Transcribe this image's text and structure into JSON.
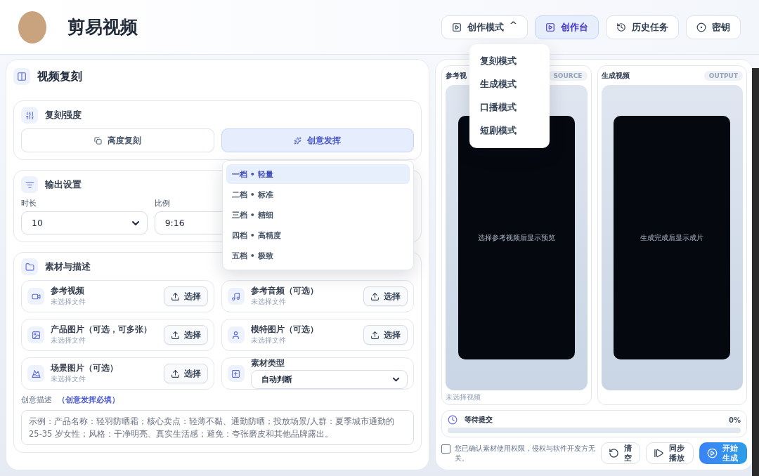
{
  "header": {
    "app_title": "剪易视频",
    "nav": [
      {
        "label": "创作模式",
        "caret": "^",
        "selected": false,
        "expanded": true
      },
      {
        "label": "创作台",
        "selected": true
      },
      {
        "label": "历史任务",
        "selected": false
      },
      {
        "label": "密钥",
        "selected": false
      }
    ]
  },
  "mode_menu": [
    "复刻模式",
    "生成模式",
    "口播模式",
    "短剧模式"
  ],
  "left_panel": {
    "title": "视频复刻",
    "strength": {
      "title": "复刻强度",
      "options": [
        {
          "label": "高度复刻",
          "selected": false
        },
        {
          "label": "创意发挥",
          "selected": true
        }
      ],
      "level_menu": [
        {
          "label": "一档 • 轻量",
          "selected": true
        },
        {
          "label": "二档 • 标准",
          "selected": false
        },
        {
          "label": "三档 • 精细",
          "selected": false
        },
        {
          "label": "四档 • 高精度",
          "selected": false
        },
        {
          "label": "五档 • 极致",
          "selected": false
        }
      ]
    },
    "output": {
      "title": "输出设置",
      "fields": [
        {
          "label": "时长",
          "value": "10"
        },
        {
          "label": "比例",
          "value": "9:16"
        }
      ]
    },
    "materials": {
      "title": "素材与描述",
      "uploads": [
        {
          "label": "参考视频",
          "status": "未选择文件",
          "button": "选择"
        },
        {
          "label": "参考音频（可选）",
          "status": "未选择文件",
          "button": "选择"
        },
        {
          "label": "产品图片（可选，可多张）",
          "status": "未选择文件",
          "button": "选择"
        },
        {
          "label": "模特图片（可选）",
          "status": "未选择文件",
          "button": "选择"
        },
        {
          "label": "场景图片（可选）",
          "status": "未选择文件",
          "button": "选择"
        }
      ],
      "type_field": {
        "label": "素材类型",
        "value": "自动判断"
      },
      "description": {
        "label": "创意描述",
        "hint": "（创意发挥必填）",
        "placeholder": "示例：产品名称：轻羽防晒霜；核心卖点：轻薄不黏、通勤防晒；投放场景/人群：夏季城市通勤的 25-35 岁女性；风格：干净明亮、真实生活感；避免：夸张磨皮和其他品牌露出。"
      }
    }
  },
  "right_panel": {
    "previews": [
      {
        "title": "参考视",
        "badge": "SOURCE",
        "message": "选择参考视频后显示预览",
        "caption": "未选择视频"
      },
      {
        "title": "生成视频",
        "badge": "OUTPUT",
        "message": "生成完成后显示成片"
      }
    ],
    "progress": {
      "status": "等待提交",
      "percent": "0%",
      "level": 0
    },
    "consent": {
      "text": "您已确认素材使用权限，侵权与软件开发方无关。",
      "checked": false
    },
    "buttons": [
      {
        "label": "清空",
        "kind": "secondary"
      },
      {
        "label": "同步播放",
        "kind": "secondary"
      },
      {
        "label": "开始生成",
        "kind": "primary"
      }
    ]
  }
}
